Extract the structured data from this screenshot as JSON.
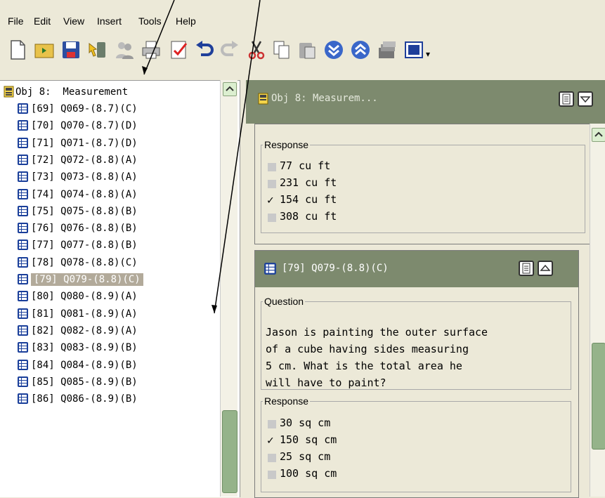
{
  "menu": [
    {
      "label": "File"
    },
    {
      "label": "Edit"
    },
    {
      "label": "View"
    },
    {
      "label": "Insert"
    },
    {
      "label": "Tools"
    },
    {
      "label": "Help"
    }
  ],
  "toolbar_icons": [
    "new-file-icon",
    "open-folder-icon",
    "save-icon",
    "import-icon",
    "users-icon",
    "print-icon",
    "check-document-icon",
    "undo-icon",
    "redo-icon",
    "cut-icon",
    "copy-icon",
    "paste-icon",
    "move-down-icon",
    "move-up-icon",
    "stack-icon",
    "image-icon"
  ],
  "tree": {
    "root_label": "Obj 8:  Measurement",
    "items": [
      {
        "label": "[69] Q069-(8.7)(C)"
      },
      {
        "label": "[70] Q070-(8.7)(D)"
      },
      {
        "label": "[71] Q071-(8.7)(D)"
      },
      {
        "label": "[72] Q072-(8.8)(A)"
      },
      {
        "label": "[73] Q073-(8.8)(A)"
      },
      {
        "label": "[74] Q074-(8.8)(A)"
      },
      {
        "label": "[75] Q075-(8.8)(B)"
      },
      {
        "label": "[76] Q076-(8.8)(B)"
      },
      {
        "label": "[77] Q077-(8.8)(B)"
      },
      {
        "label": "[78] Q078-(8.8)(C)"
      },
      {
        "label": "[79] Q079-(8.8)(C)",
        "selected": true
      },
      {
        "label": "[80] Q080-(8.9)(A)"
      },
      {
        "label": "[81] Q081-(8.9)(A)"
      },
      {
        "label": "[82] Q082-(8.9)(A)"
      },
      {
        "label": "[83] Q083-(8.9)(B)"
      },
      {
        "label": "[84] Q084-(8.9)(B)"
      },
      {
        "label": "[85] Q085-(8.9)(B)"
      },
      {
        "label": "[86] Q086-(8.9)(B)"
      }
    ]
  },
  "detail": {
    "header_title": "Obj 8:  Measurem...",
    "prev_card": {
      "response_legend": "Response",
      "responses": [
        {
          "text": "77 cu ft",
          "checked": false
        },
        {
          "text": "231 cu ft",
          "checked": false
        },
        {
          "text": "154 cu ft",
          "checked": true
        },
        {
          "text": "308 cu ft",
          "checked": false
        }
      ]
    },
    "card": {
      "title": "[79] Q079-(8.8)(C)",
      "question_legend": "Question",
      "question_text": "Jason is painting the outer surface\nof a cube having sides measuring\n5 cm. What is the total area he\nwill have to paint?",
      "response_legend": "Response",
      "responses": [
        {
          "text": "30 sq cm",
          "checked": false
        },
        {
          "text": "150 sq cm",
          "checked": true
        },
        {
          "text": "25 sq cm",
          "checked": false
        },
        {
          "text": "100 sq cm",
          "checked": false
        }
      ]
    }
  },
  "check_mark": "✓",
  "colors": {
    "header": "#7d8a6e",
    "selection": "#b2aa9a",
    "scroll_thumb": "#95b38a"
  }
}
